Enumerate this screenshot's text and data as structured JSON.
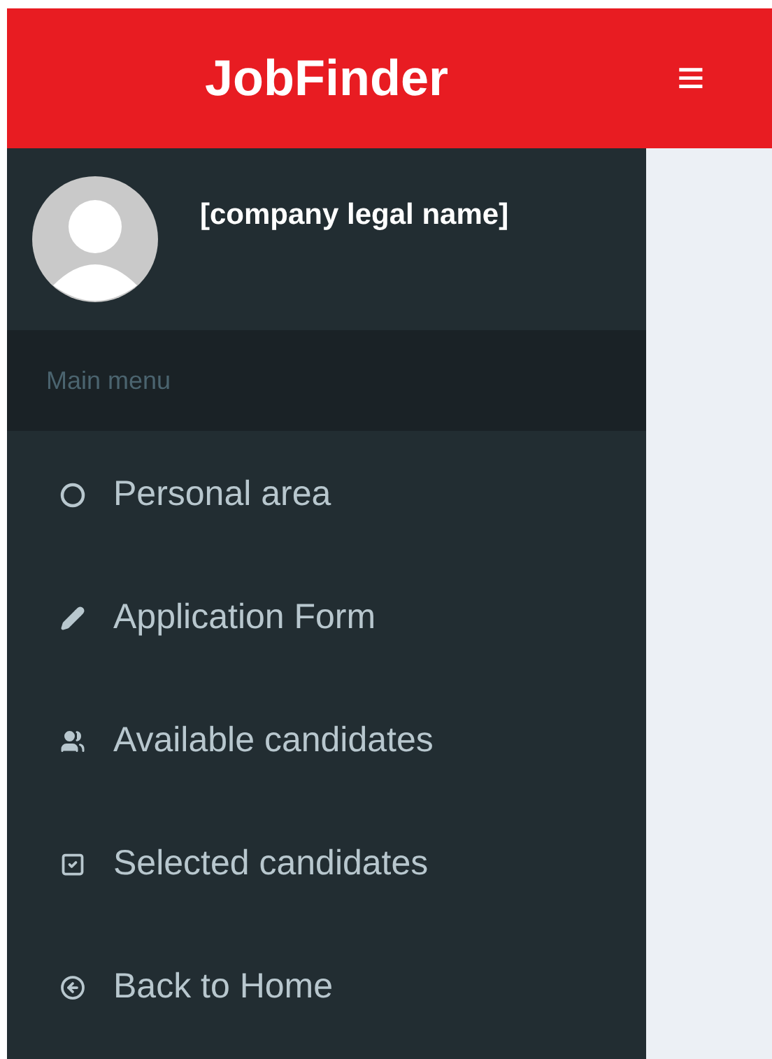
{
  "header": {
    "logo": "JobFinder",
    "menu_toggle": "≡"
  },
  "sidebar": {
    "user_name": "[company legal name]",
    "section_title": "Main menu",
    "items": [
      {
        "label": "Personal area",
        "kind": "circle"
      },
      {
        "label": "Application Form",
        "kind": "pencil"
      },
      {
        "label": "Available candidates",
        "kind": "users"
      },
      {
        "label": "Selected candidates",
        "kind": "check"
      },
      {
        "label": "Back to Home",
        "kind": "back"
      }
    ]
  }
}
